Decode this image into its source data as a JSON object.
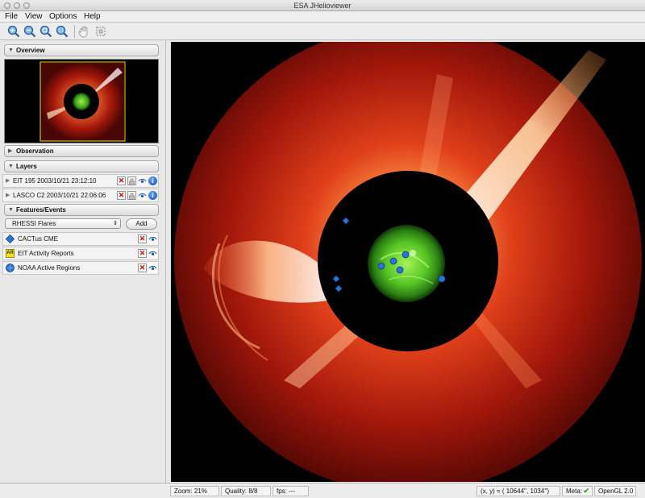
{
  "window": {
    "title": "ESA JHelioviewer"
  },
  "menu": {
    "items": [
      "File",
      "View",
      "Options",
      "Help"
    ]
  },
  "toolbar": {
    "buttons": [
      "zoom-in-icon",
      "zoom-out-icon",
      "zoom-fit-icon",
      "zoom-one-to-one-icon",
      "pan-hand-icon",
      "select-region-icon"
    ]
  },
  "sidebar": {
    "overview_label": "Overview",
    "observation_label": "Observation",
    "layers_label": "Layers",
    "layers": [
      {
        "name": "EIT 195 2003/10/21 23:12:10"
      },
      {
        "name": "LASCO C2 2003/10/21 22:06:06"
      }
    ],
    "features_label": "Features/Events",
    "catalog_select": "RHESSI Flares",
    "add_button": "Add",
    "events": [
      {
        "name": "CACTus CME",
        "icon": "blue-diamond-icon",
        "badge": ""
      },
      {
        "name": "EIT Activity Reports",
        "icon": "ar-badge-icon",
        "badge": "AR"
      },
      {
        "name": "NOAA Active Regions",
        "icon": "noaa-globe-icon",
        "badge": ""
      }
    ]
  },
  "status": {
    "zoom": "Zoom: 21%",
    "quality": "Quality: 8/8",
    "fps": "fps: ---",
    "coords": "(x, y) = ( 10644'',  1034'')",
    "meta": "Meta:",
    "renderer": "OpenGL 2.0"
  },
  "colors": {
    "corona": "#c8200f",
    "sun_green": "#3cb81a",
    "event_marker": "#2a74d6"
  }
}
